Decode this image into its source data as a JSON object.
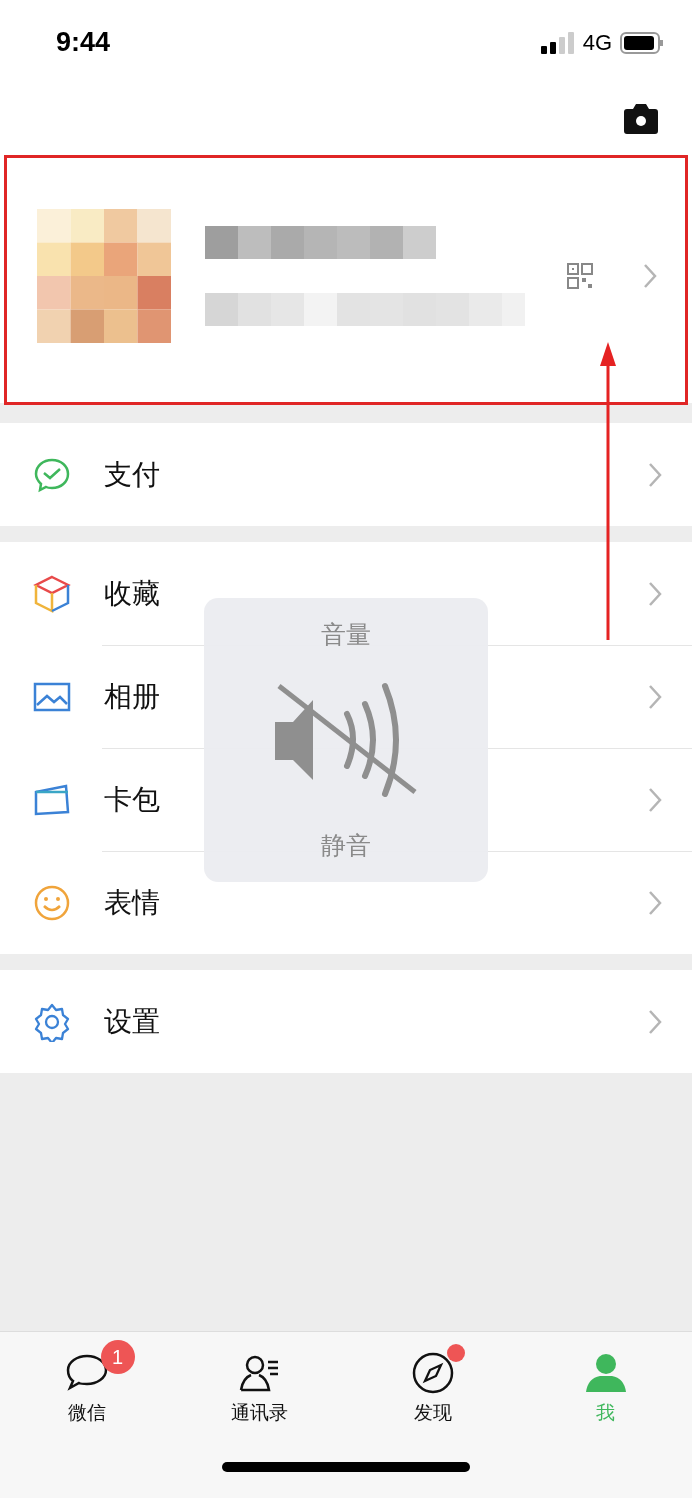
{
  "status_bar": {
    "time": "9:44",
    "network": "4G"
  },
  "annotations": {
    "highlight_box": true,
    "arrow": true
  },
  "menu_groups": [
    {
      "items": [
        {
          "kind": "pay",
          "label": "支付"
        }
      ]
    },
    {
      "items": [
        {
          "kind": "favorites",
          "label": "收藏"
        },
        {
          "kind": "album",
          "label": "相册"
        },
        {
          "kind": "cards",
          "label": "卡包"
        },
        {
          "kind": "stickers",
          "label": "表情"
        }
      ]
    },
    {
      "items": [
        {
          "kind": "settings",
          "label": "设置"
        }
      ]
    }
  ],
  "volume_hud": {
    "title": "音量",
    "status": "静音",
    "muted": true
  },
  "tab_bar": [
    {
      "kind": "chats",
      "label": "微信",
      "selected": false,
      "badge": "1"
    },
    {
      "kind": "contacts",
      "label": "通讯录",
      "selected": false
    },
    {
      "kind": "discover",
      "label": "发现",
      "selected": false,
      "dot": true
    },
    {
      "kind": "me",
      "label": "我",
      "selected": true
    }
  ]
}
